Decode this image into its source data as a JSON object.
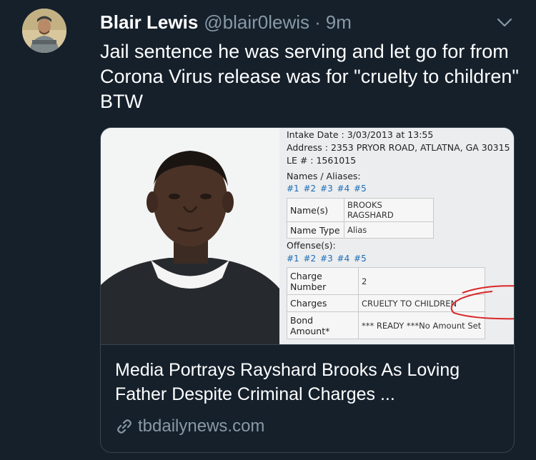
{
  "tweet": {
    "author_name": "Blair Lewis",
    "handle": "@blair0lewis",
    "separator": "·",
    "time": "9m",
    "text": "Jail sentence he was serving and let go for from Corona Virus release was for \"cruelty to children\" BTW"
  },
  "card": {
    "title": "Media Portrays Rayshard Brooks As Loving Father Despite Criminal Charges ...",
    "domain": "tbdailynews.com",
    "record": {
      "intake_label": "Intake Date :",
      "intake_value": "3/03/2013 at 13:55",
      "address_label": "Address :",
      "address_value": "2353 PRYOR ROAD, ATLATNA, GA 30315",
      "le_label": "LE # :",
      "le_value": "1561015",
      "names_heading": "Names / Aliases:",
      "names_links": "#1 #2 #3 #4 #5",
      "names_table": [
        {
          "label": "Name(s)",
          "value": "BROOKS RAGSHARD"
        },
        {
          "label": "Name Type",
          "value": "Alias"
        }
      ],
      "offense_heading": "Offense(s):",
      "offense_links": "#1 #2 #3 #4 #5",
      "offense_table": [
        {
          "label": "Charge Number",
          "value": "2"
        },
        {
          "label": "Charges",
          "value": "CRUELTY TO CHILDREN"
        },
        {
          "label": "Bond Amount*",
          "value": "*** READY ***No Amount Set"
        }
      ]
    }
  },
  "icons": {
    "caret": "chevron-down-icon",
    "link": "link-icon",
    "avatar": "avatar"
  },
  "colors": {
    "background": "#15202b",
    "secondary_text": "#8899a6",
    "border": "#38444d",
    "annotation_circle": "#d9262a"
  }
}
